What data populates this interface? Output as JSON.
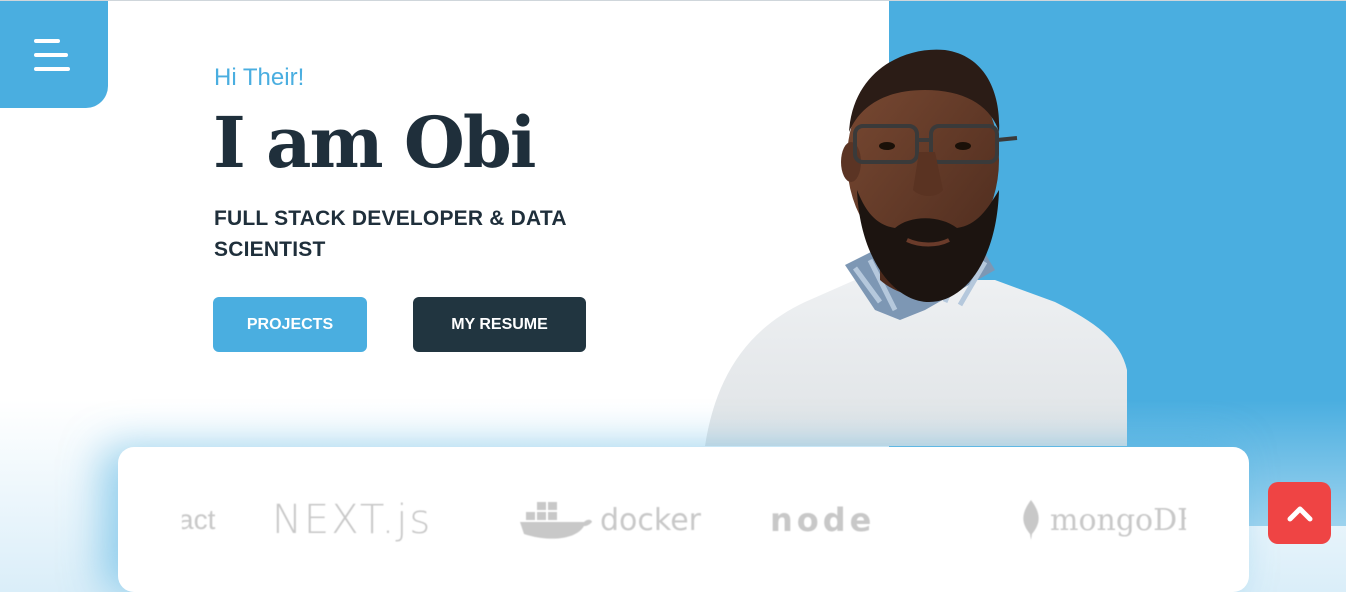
{
  "nav": {
    "menu_icon": "hamburger-icon"
  },
  "hero": {
    "greeting": "Hi Their!",
    "headline": "I am Obi",
    "role": "FULL STACK DEVELOPER & DATA SCIENTIST",
    "projects_label": "PROJECTS",
    "resume_label": "MY RESUME"
  },
  "tech_logos": [
    {
      "name": "react",
      "text": "act"
    },
    {
      "name": "nextjs",
      "text": "NEXT.js"
    },
    {
      "name": "docker",
      "text": "docker"
    },
    {
      "name": "nodejs",
      "text": "node"
    },
    {
      "name": "mongodb",
      "text": "mongoDB"
    }
  ],
  "scroll_top": {
    "icon": "chevron-up-icon"
  },
  "colors": {
    "accent": "#4aaee0",
    "dark": "#213540",
    "danger": "#ef4444",
    "text": "#1f2f3b"
  }
}
